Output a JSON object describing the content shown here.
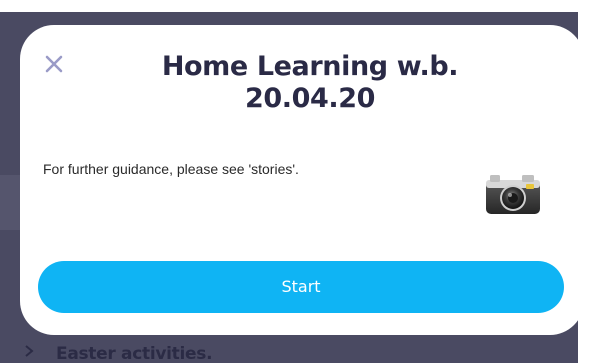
{
  "modal": {
    "title": "Home Learning w.b. 20.04.20",
    "message": "For further guidance, please see 'stories'.",
    "start_label": "Start",
    "close_icon": "close-icon",
    "attachment_icon": "camera-icon"
  },
  "background": {
    "peek_text": "Easter activities."
  },
  "colors": {
    "accent": "#0fb4f4",
    "title": "#2a2a46",
    "backdrop": "#4a4a62",
    "close_icon": "#9a9bc7"
  }
}
